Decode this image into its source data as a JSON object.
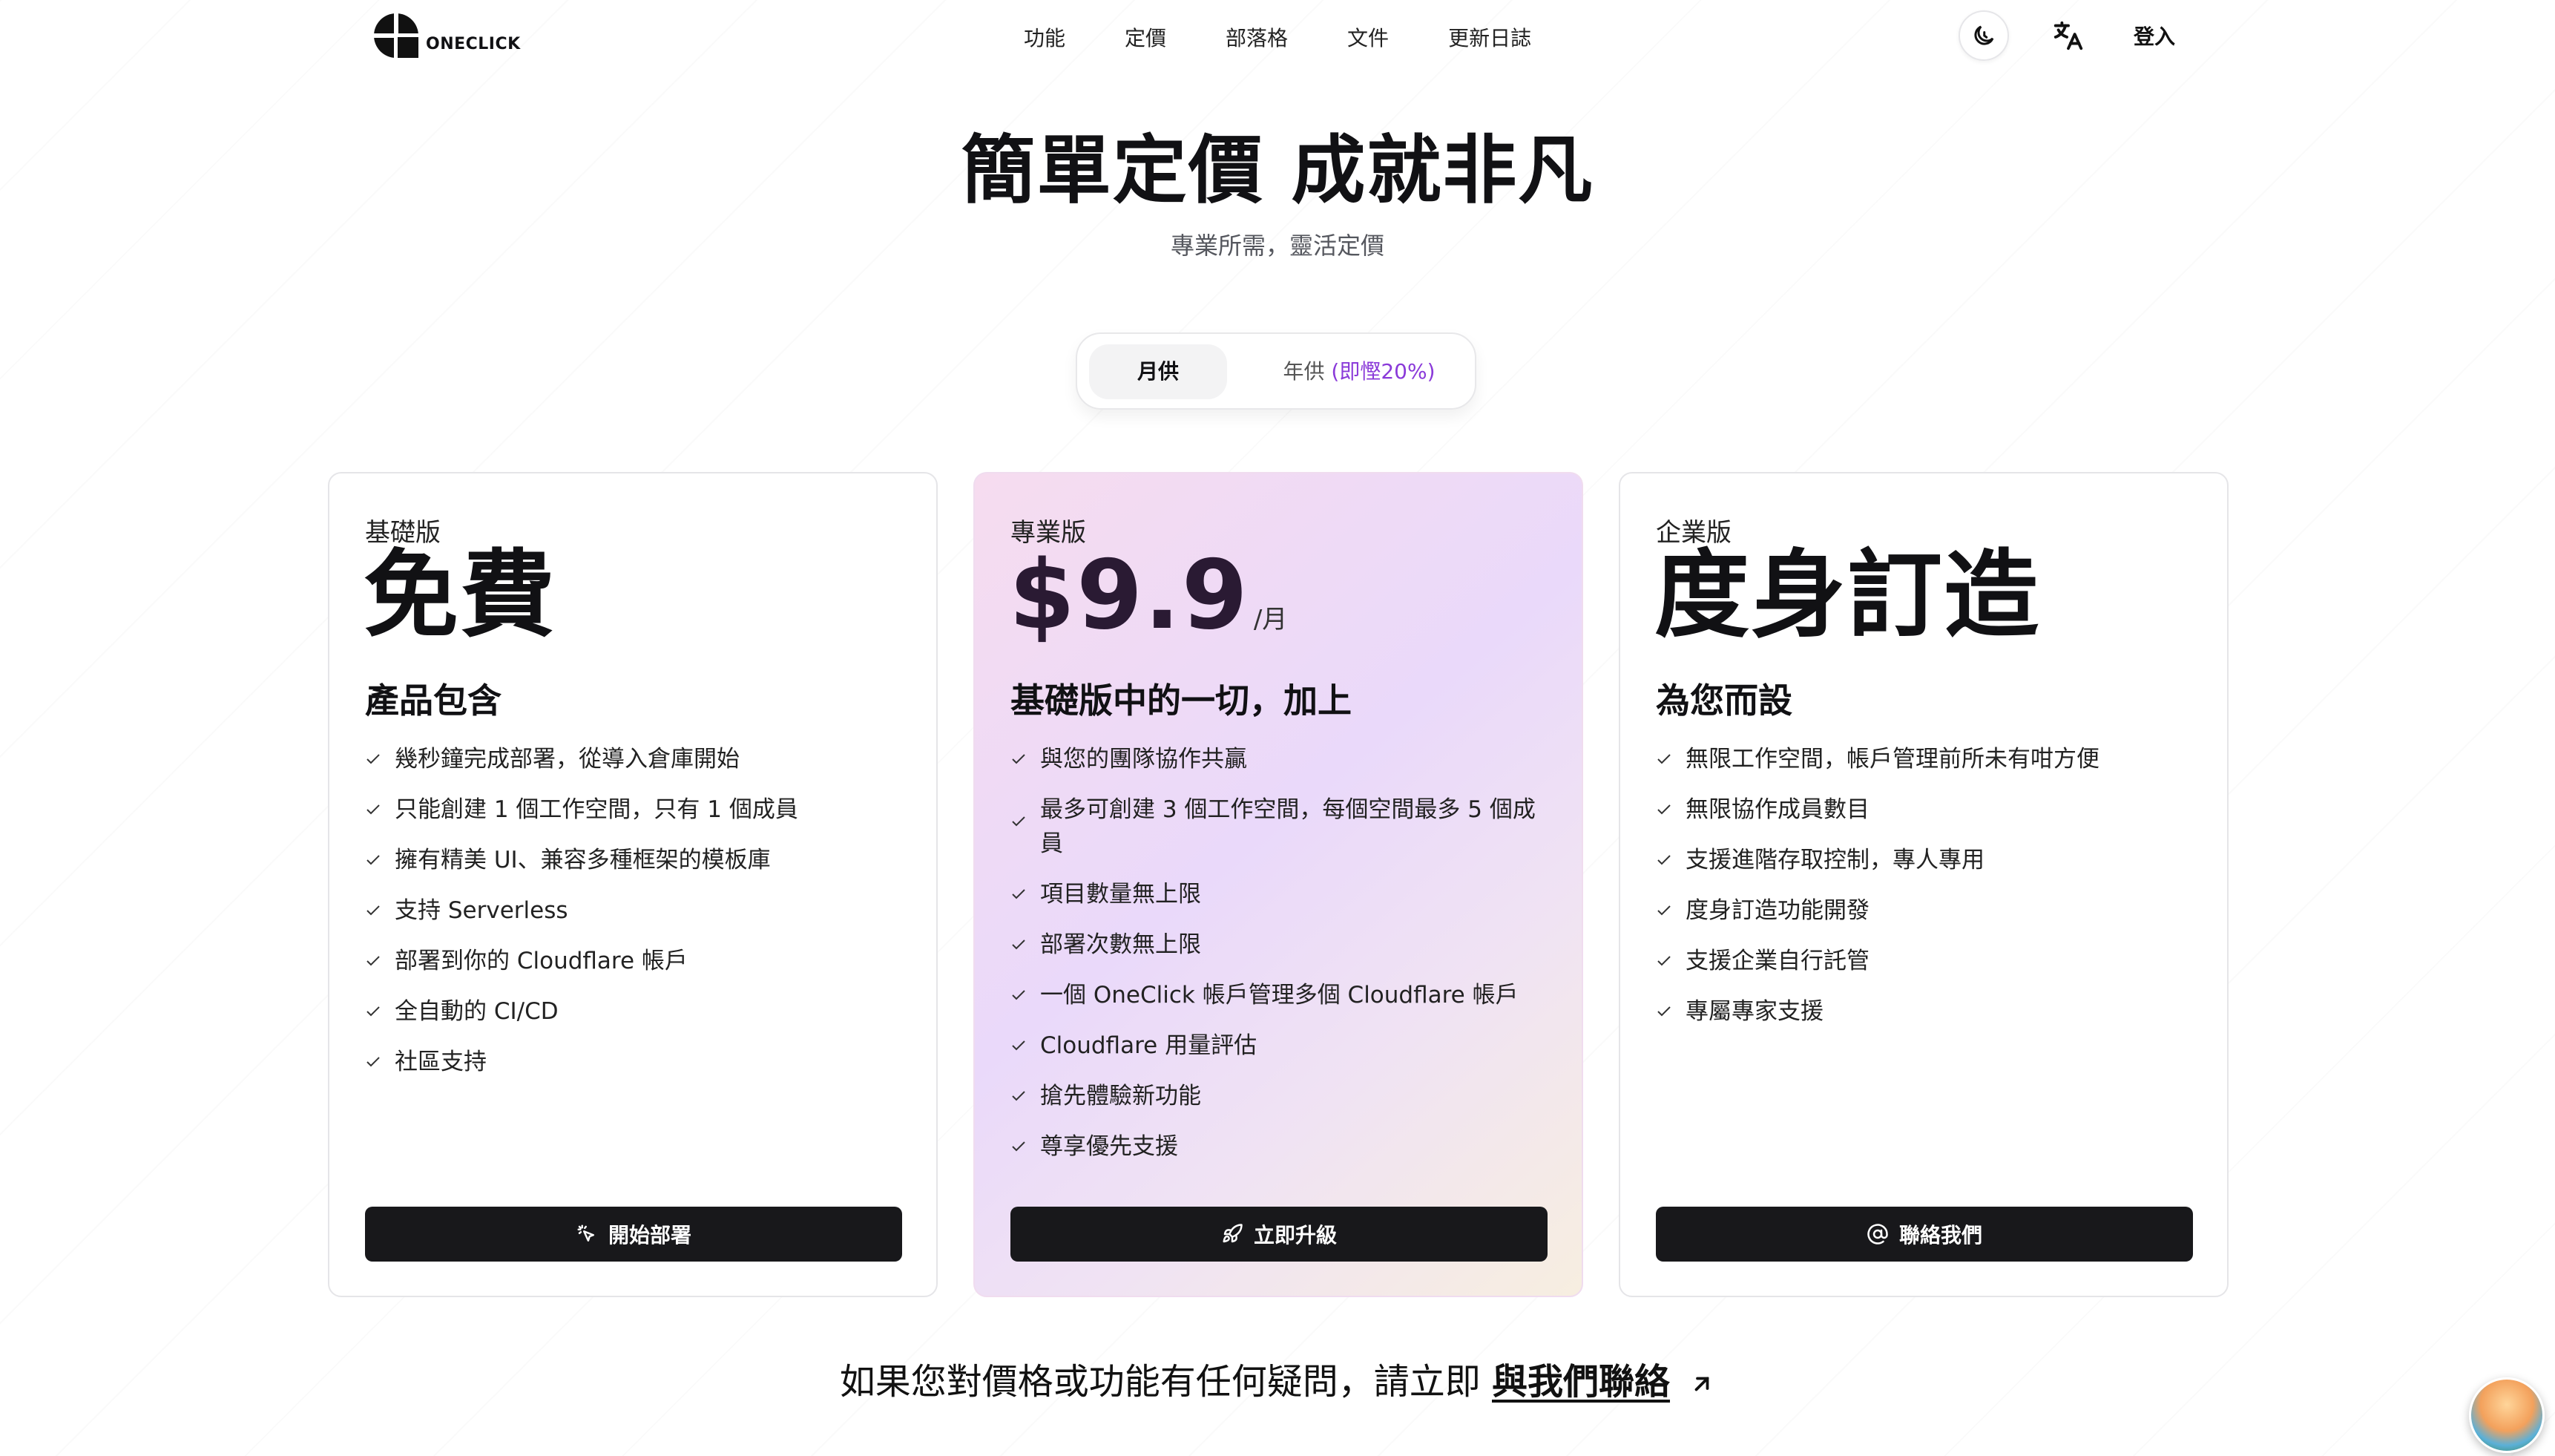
{
  "brand": {
    "name": "ONECLICK"
  },
  "nav": {
    "items": [
      "功能",
      "定價",
      "部落格",
      "文件",
      "更新日誌"
    ]
  },
  "header": {
    "login": "登入",
    "theme_icon": "moon-clock-icon",
    "lang_icon": "translate-icon"
  },
  "hero": {
    "title": "簡單定價 成就非凡",
    "subtitle": "專業所需，靈活定價"
  },
  "billing": {
    "monthly": "月供",
    "yearly": "年供",
    "discount": "(即慳20%)",
    "selected": "monthly"
  },
  "plans": [
    {
      "tier": "基礎版",
      "price": "免費",
      "per": "",
      "feature_title": "產品包含",
      "features": [
        "幾秒鐘完成部署，從導入倉庫開始",
        "只能創建 1 個工作空間，只有 1 個成員",
        "擁有精美 UI、兼容多種框架的模板庫",
        "支持 Serverless",
        "部署到你的 Cloudflare 帳戶",
        "全自動的 CI/CD",
        "社區支持"
      ],
      "cta": "開始部署",
      "cta_icon": "pointer-click-icon"
    },
    {
      "tier": "專業版",
      "price": "$9.9",
      "per": "/月",
      "feature_title": "基礎版中的一切，加上",
      "features": [
        "與您的團隊協作共贏",
        "最多可創建 3 個工作空間，每個空間最多 5 個成員",
        "項目數量無上限",
        "部署次數無上限",
        "一個 OneClick 帳戶管理多個 Cloudflare 帳戶",
        "Cloudflare 用量評估",
        "搶先體驗新功能",
        "尊享優先支援"
      ],
      "cta": "立即升級",
      "cta_icon": "rocket-icon"
    },
    {
      "tier": "企業版",
      "price": "度身訂造",
      "per": "",
      "feature_title": "為您而設",
      "features": [
        "無限工作空間，帳戶管理前所未有咁方便",
        "無限協作成員數目",
        "支援進階存取控制，專人專用",
        "度身訂造功能開發",
        "支援企業自行託管",
        "專屬專家支援"
      ],
      "cta": "聯絡我們",
      "cta_icon": "at-sign-icon"
    }
  ],
  "contact": {
    "prefix": "如果您對價格或功能有任何疑問，請立即",
    "link": "與我們聯絡"
  },
  "colors": {
    "accent_purple": "#8a3ad9",
    "button_dark": "#18181b"
  }
}
